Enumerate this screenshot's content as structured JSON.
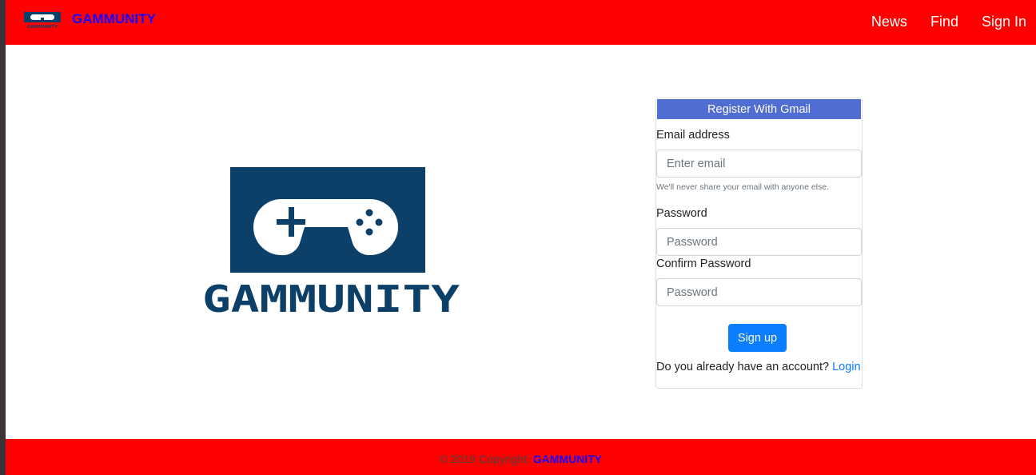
{
  "navbar": {
    "brand": "GAMMUNITY",
    "brand_logo_text": "GAMMUNITY",
    "links": [
      {
        "label": "News"
      },
      {
        "label": "Find"
      },
      {
        "label": "Sign In"
      }
    ],
    "color": "#ff0000"
  },
  "hero": {
    "logo_text": "GAMMUNITY",
    "logo_color": "#0d4068",
    "icon": "gamepad-icon"
  },
  "register": {
    "header": "Register With Gmail",
    "email_label": "Email address",
    "email_placeholder": "Enter email",
    "email_help": "We'll never share your email with anyone else.",
    "password_label": "Password",
    "password_placeholder": "Password",
    "confirm_label": "Confirm Password",
    "confirm_placeholder": "Password",
    "submit": "Sign up",
    "account_prompt": "Do you already have an account?",
    "login_link": "Login",
    "header_color": "#4f6dd3",
    "button_color": "#0b7dff"
  },
  "footer": {
    "copyright": "© 2019 Copyright:",
    "brand": "GAMMUNITY"
  }
}
